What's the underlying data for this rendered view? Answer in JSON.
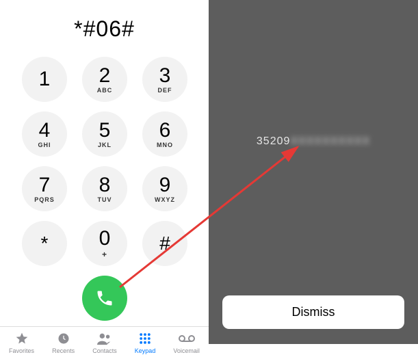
{
  "dialed": "*#06#",
  "keys": [
    {
      "d": "1",
      "l": ""
    },
    {
      "d": "2",
      "l": "ABC"
    },
    {
      "d": "3",
      "l": "DEF"
    },
    {
      "d": "4",
      "l": "GHI"
    },
    {
      "d": "5",
      "l": "JKL"
    },
    {
      "d": "6",
      "l": "MNO"
    },
    {
      "d": "7",
      "l": "PQRS"
    },
    {
      "d": "8",
      "l": "TUV"
    },
    {
      "d": "9",
      "l": "WXYZ"
    },
    {
      "d": "*",
      "l": ""
    },
    {
      "d": "0",
      "l": "+"
    },
    {
      "d": "#",
      "l": ""
    }
  ],
  "tabs": {
    "favorites": "Favorites",
    "recents": "Recents",
    "contacts": "Contacts",
    "keypad": "Keypad",
    "voicemail": "Voicemail"
  },
  "imei": {
    "visible": "35209",
    "hidden": "XXXXXXXXXX"
  },
  "dismiss": "Dismiss"
}
